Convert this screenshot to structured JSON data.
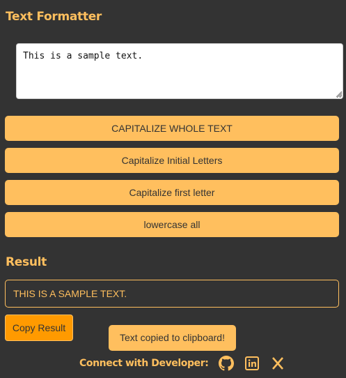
{
  "app": {
    "title": "Text Formatter"
  },
  "input": {
    "value": "This is a sample text."
  },
  "buttons": {
    "uppercase": "CAPITALIZE WHOLE TEXT",
    "title_case": "Capitalize Initial Letters",
    "sentence_case": "Capitalize first letter",
    "lowercase": "lowercase all"
  },
  "result": {
    "heading": "Result",
    "value": "THIS IS A SAMPLE TEXT.",
    "copy_label": "Copy Result"
  },
  "toast": {
    "message": "Text copied to clipboard!"
  },
  "footer": {
    "label": "Connect with Developer:",
    "icons": [
      "github-icon",
      "linkedin-icon",
      "x-icon"
    ]
  },
  "colors": {
    "background": "#333333",
    "accent": "#ffbf5e",
    "copy_button": "#ff9a00",
    "input_background": "#ffffff"
  }
}
